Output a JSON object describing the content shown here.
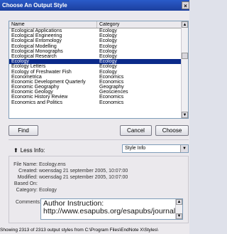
{
  "window": {
    "title": "Choose An Output Style",
    "close_label": "×"
  },
  "list": {
    "columns": {
      "name": "Name",
      "category": "Category"
    },
    "rows": [
      {
        "name": "Ecological Applications",
        "category": "Ecology"
      },
      {
        "name": "Ecological Engineering",
        "category": "Ecology"
      },
      {
        "name": "Ecological Entomology",
        "category": "Ecology"
      },
      {
        "name": "Ecological Modelling",
        "category": "Ecology"
      },
      {
        "name": "Ecological Monographs",
        "category": "Ecology"
      },
      {
        "name": "Ecological Research",
        "category": "Ecology"
      },
      {
        "name": "Ecology",
        "category": "Ecology"
      },
      {
        "name": "Ecology Letters",
        "category": "Ecology"
      },
      {
        "name": "Ecology of Freshwater Fish",
        "category": "Ecology"
      },
      {
        "name": "Econometrica",
        "category": "Economics"
      },
      {
        "name": "Economic Development Quarterly",
        "category": "Economics"
      },
      {
        "name": "Economic Geography",
        "category": "Geography"
      },
      {
        "name": "Economic Geology",
        "category": "Geosciences"
      },
      {
        "name": "Economic History Review",
        "category": "Economics"
      },
      {
        "name": "Economics and Politics",
        "category": "Economics"
      }
    ],
    "selected_index": 6,
    "scroll_up_icon": "triangle-up-icon",
    "scroll_down_icon": "triangle-down-icon"
  },
  "buttons": {
    "find": "Find",
    "cancel": "Cancel",
    "choose": "Choose"
  },
  "toggle": {
    "label": "Less Info:",
    "icon": "up-arrow-icon"
  },
  "info_select": {
    "value": "Style Info",
    "arrow": "▼"
  },
  "details": {
    "file_name_label": "File Name:",
    "file_name": "Ecology.ens",
    "created_label": "Created:",
    "created": "woensdag 21 september 2005, 10:07:00",
    "modified_label": "Modified:",
    "modified": "woensdag 21 september 2005, 10:07:00",
    "based_on_label": "Based On:",
    "based_on": "",
    "category_label": "Category:",
    "category": "Ecology",
    "comments_label": "Comments:",
    "comments_line1": "Author Instruction:",
    "comments_line2": "http://www.esapubs.org/esapubs/journals/e"
  },
  "status": "Showing 2313 of 2313 output styles from C:\\Program Files\\EndNote X\\Styles\\"
}
